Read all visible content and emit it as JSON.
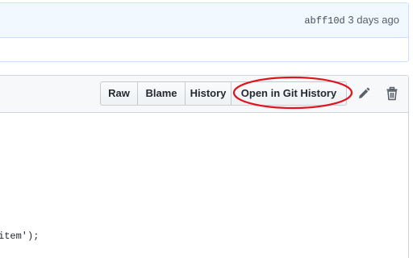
{
  "commit": {
    "sha": "abff10d",
    "time": "3 days ago"
  },
  "file": {
    "buttons": {
      "raw": "Raw",
      "blame": "Blame",
      "history": "History",
      "open_git_history": "Open in Git History"
    },
    "icons": {
      "edit": "pencil-icon",
      "delete": "trash-icon"
    },
    "code_fragment": "item');"
  },
  "annotation": {
    "color": "#e0141e"
  }
}
